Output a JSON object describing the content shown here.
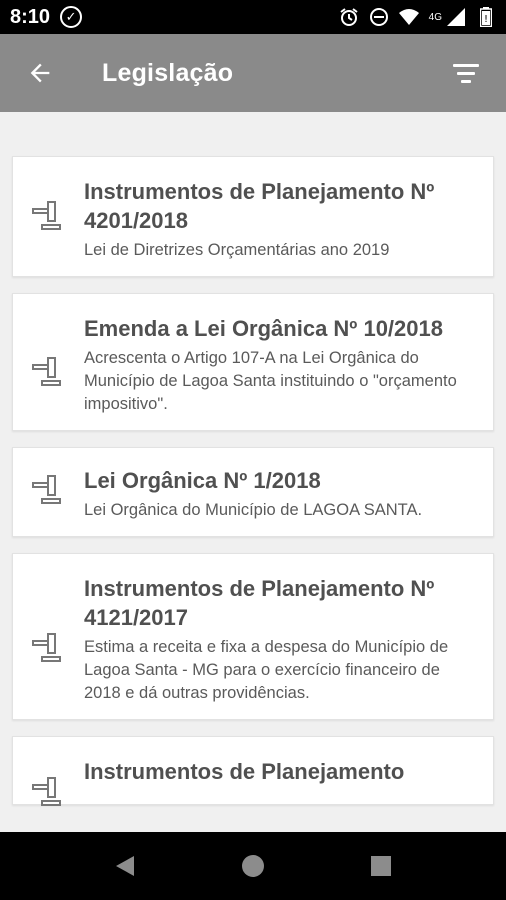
{
  "status_bar": {
    "time": "8:10",
    "network": "4G"
  },
  "app_bar": {
    "title": "Legislação",
    "back_icon": "arrow-back-icon",
    "filter_icon": "filter-icon"
  },
  "items": [
    {
      "title": "Instrumentos de Planejamento Nº 4201/2018",
      "description": "Lei de Diretrizes Orçamentárias ano 2019"
    },
    {
      "title": "Emenda a Lei Orgânica Nº 10/2018",
      "description": "Acrescenta o Artigo 107-A na Lei Orgânica do Município de Lagoa Santa instituindo o \"orçamento impositivo\"."
    },
    {
      "title": "Lei Orgânica Nº 1/2018",
      "description": "Lei Orgânica do Município de LAGOA SANTA."
    },
    {
      "title": "Instrumentos de Planejamento Nº 4121/2017",
      "description": "Estima a receita e fixa a despesa do Município de Lagoa Santa - MG para o exercício financeiro de 2018 e dá outras providências."
    },
    {
      "title": "Instrumentos de Planejamento",
      "description": ""
    }
  ],
  "colors": {
    "app_bar": "#8a8a8a",
    "background": "#f0f0f0",
    "card": "#ffffff",
    "title_text": "#505050"
  }
}
